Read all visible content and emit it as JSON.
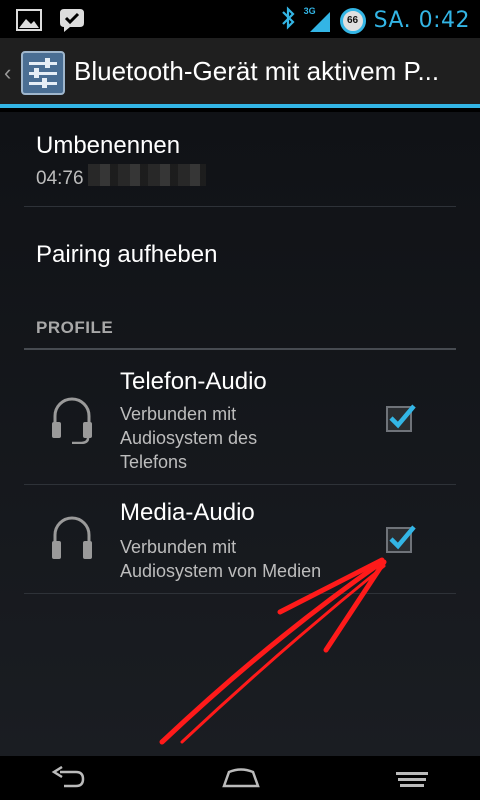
{
  "status_bar": {
    "network": "3G",
    "battery": "66",
    "time": "SA. 0:42"
  },
  "action_bar": {
    "title": "Bluetooth-Gerät mit aktivem P..."
  },
  "device": {
    "rename_label": "Umbenennen",
    "address_visible": "04:76",
    "unpair_label": "Pairing aufheben"
  },
  "profiles": {
    "header": "PROFILE",
    "items": [
      {
        "title": "Telefon-Audio",
        "line1": "Verbunden mit",
        "line2": "Audiosystem des",
        "line3": "Telefons",
        "checked": true
      },
      {
        "title": "Media-Audio",
        "line1": "Verbunden mit",
        "line2": "Audiosystem von Medien",
        "line3": "",
        "checked": true
      }
    ]
  },
  "colors": {
    "accent": "#33b5e5",
    "annotation_arrow": "#ff1a1a"
  }
}
